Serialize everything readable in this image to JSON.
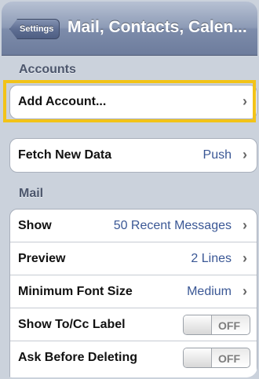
{
  "navbar": {
    "back_label": "Settings",
    "title": "Mail, Contacts, Calen..."
  },
  "sections": {
    "accounts_header": "Accounts",
    "mail_header": "Mail"
  },
  "accounts": {
    "add_account_label": "Add Account..."
  },
  "fetch": {
    "label": "Fetch New Data",
    "value": "Push"
  },
  "mail": {
    "show_label": "Show",
    "show_value": "50 Recent Messages",
    "preview_label": "Preview",
    "preview_value": "2 Lines",
    "min_font_label": "Minimum Font Size",
    "min_font_value": "Medium",
    "tocc_label": "Show To/Cc Label",
    "tocc_state": "OFF",
    "ask_delete_label": "Ask Before Deleting",
    "ask_delete_state": "OFF"
  },
  "icons": {
    "chevron": "›"
  },
  "colors": {
    "highlight_border": "#f2c318",
    "value_text": "#3a5795"
  }
}
